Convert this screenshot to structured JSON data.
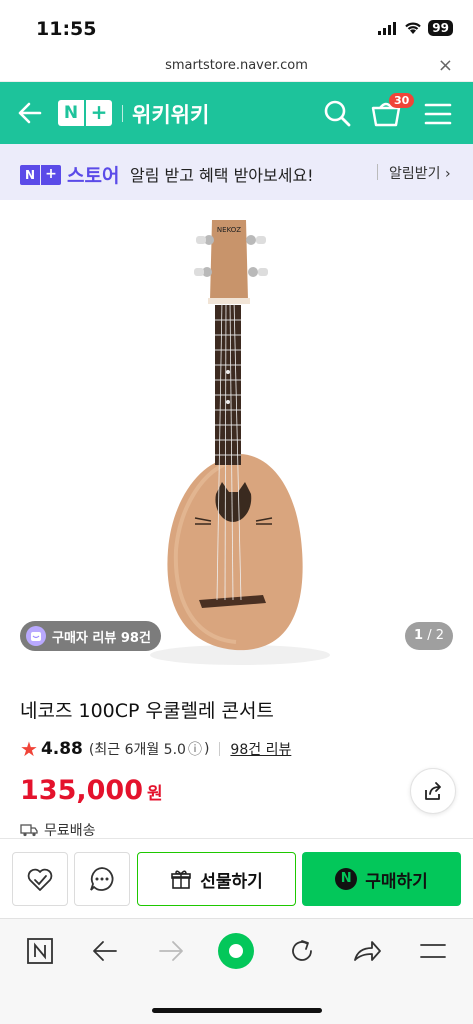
{
  "status_bar": {
    "time": "11:55",
    "battery": "99"
  },
  "url_bar": {
    "url": "smartstore.naver.com",
    "close_label": "×"
  },
  "header": {
    "logo_n": "N",
    "logo_plus": "+",
    "title": "위키위키",
    "cart_count": "30"
  },
  "notice": {
    "store_n": "N",
    "store_plus": "+",
    "store_label": "스토어",
    "text": "알림 받고 혜택 받아보세요!",
    "link": "알림받기 ›"
  },
  "image": {
    "review_badge": "구매자 리뷰 98건",
    "page_current": "1",
    "page_total": "/ 2",
    "brand_text": "NEKOZ"
  },
  "product": {
    "title": "네코즈 100CP 우쿨렐레 콘서트",
    "rating": "4.88",
    "rating_recent": "(최근 6개월 5.0",
    "rating_info": "ⓘ",
    "rating_close": ")",
    "review_count": "98건 리뷰",
    "price": "135,000",
    "currency": "원",
    "shipping": "무료배송"
  },
  "actions": {
    "gift": "선물하기",
    "buy": "구매하기",
    "npay_n": "N"
  },
  "colors": {
    "header_green": "#1dc39b",
    "store_purple": "#5b4be8",
    "price_red": "#e4122c",
    "buy_green": "#03c75a"
  }
}
